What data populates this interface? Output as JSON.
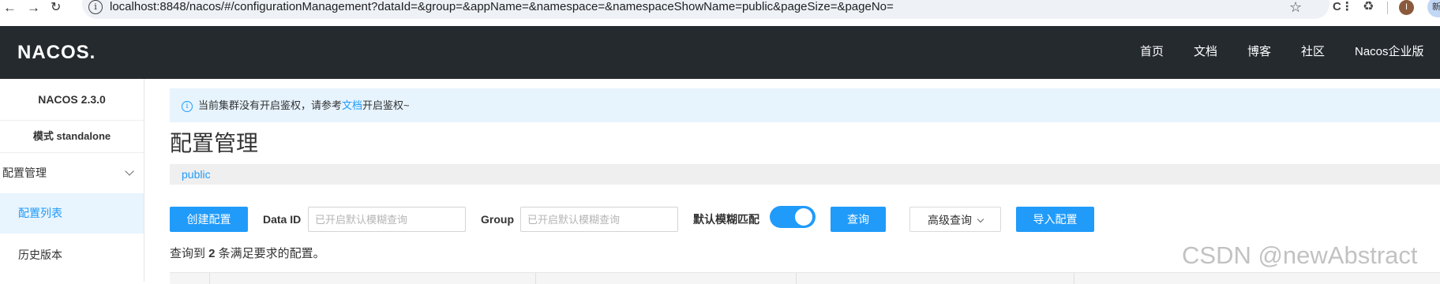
{
  "browser": {
    "url": "localhost:8848/nacos/#/configurationManagement?dataId=&group=&appName=&namespace=&namespaceShowName=public&pageSize=&pageNo=",
    "avatar_letter": "I",
    "avatar2_letter": "新"
  },
  "header": {
    "logo": "NACOS.",
    "nav": [
      "首页",
      "文档",
      "博客",
      "社区",
      "Nacos企业版"
    ]
  },
  "sidebar": {
    "version": "NACOS 2.3.0",
    "mode": "模式 standalone",
    "group_label": "配置管理",
    "items": [
      {
        "label": "配置列表",
        "active": true
      },
      {
        "label": "历史版本",
        "active": false
      }
    ]
  },
  "notice": {
    "text_before": "当前集群没有开启鉴权，请参考",
    "link": "文档",
    "text_after": "开启鉴权~"
  },
  "main": {
    "title": "配置管理",
    "namespace": "public",
    "create_button": "创建配置",
    "dataid_label": "Data ID",
    "dataid_placeholder": "已开启默认模糊查询",
    "group_label": "Group",
    "group_placeholder": "已开启默认模糊查询",
    "fuzzy_label": "默认模糊匹配",
    "fuzzy_enabled": true,
    "search_button": "查询",
    "advanced_button": "高级查询",
    "import_button": "导入配置",
    "result_prefix": "查询到 ",
    "result_count": "2",
    "result_suffix": " 条满足要求的配置。"
  },
  "watermark": "CSDN @newAbstract",
  "colors": {
    "primary": "#209bfa",
    "header_bg": "#252a2f",
    "notice_bg": "#e7f4fe"
  }
}
